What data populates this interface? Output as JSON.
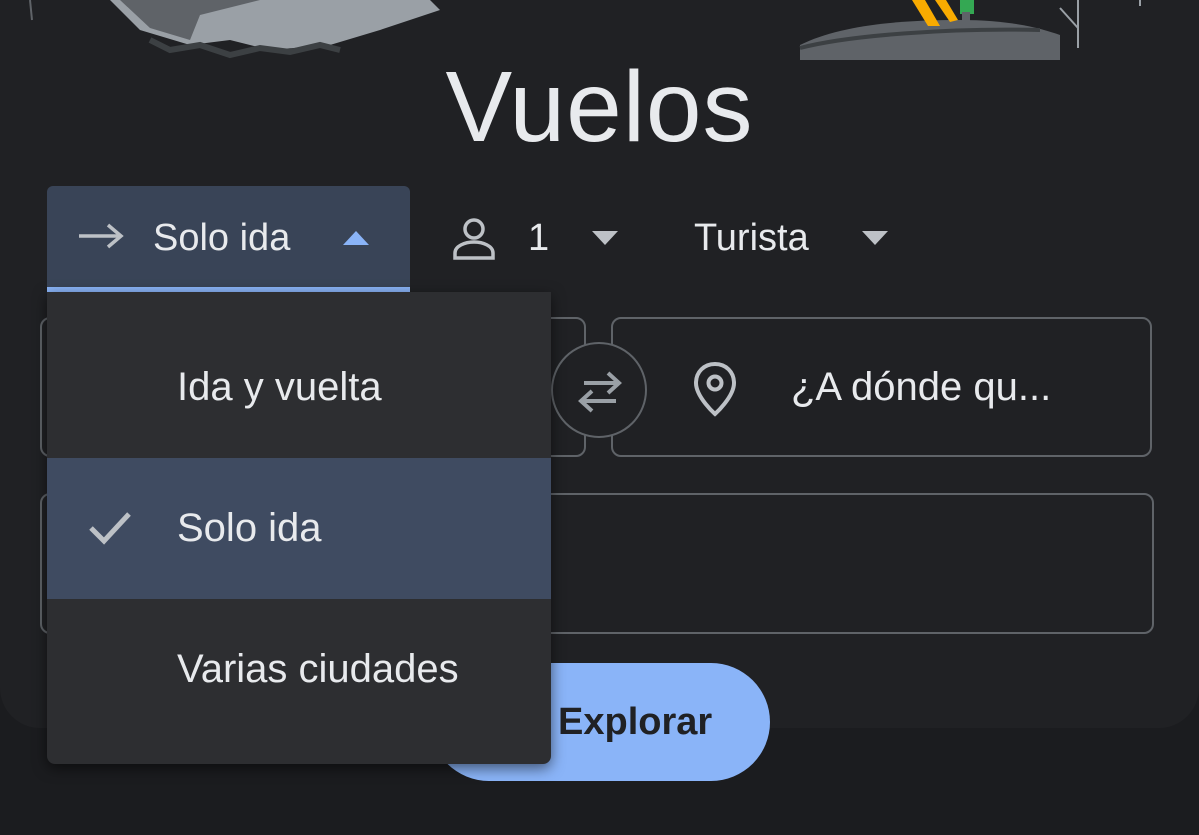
{
  "header": {
    "title": "Vuelos"
  },
  "trip_type": {
    "selected_label": "Solo ida",
    "options": [
      {
        "label": "Ida y vuelta",
        "selected": false
      },
      {
        "label": "Solo ida",
        "selected": true
      },
      {
        "label": "Varias ciudades",
        "selected": false
      }
    ]
  },
  "passengers": {
    "count": "1"
  },
  "cabin_class": {
    "label": "Turista"
  },
  "destination": {
    "placeholder": "¿A dónde qu..."
  },
  "explore_button": {
    "label": "Explorar"
  },
  "colors": {
    "background": "#202124",
    "accent": "#8ab4f8",
    "selected_row": "#3f4b61",
    "menu_bg": "#2d2e31"
  },
  "icons": {
    "trip_type": "arrow-right-icon",
    "passengers": "person-icon",
    "destination": "location-pin-icon",
    "swap": "swap-arrows-icon",
    "check": "check-icon",
    "caret": "caret-icon"
  }
}
